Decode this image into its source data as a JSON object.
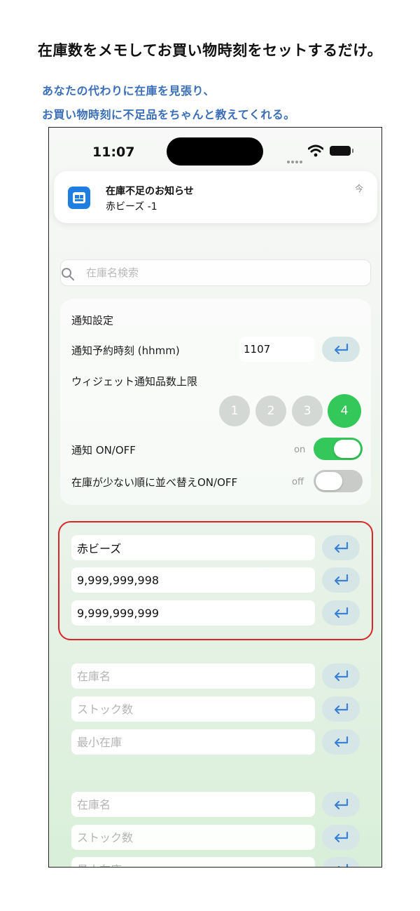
{
  "promo": {
    "headline": "在庫数をメモしてお買い物時刻をセットするだけ。",
    "subline1": "あなたの代わりに在庫を見張り、",
    "subline2": "お買い物時刻に不足品をちゃんと教えてくれる。"
  },
  "status_bar": {
    "time": "11:07"
  },
  "notification": {
    "title": "在庫不足のお知らせ",
    "body": "赤ビーズ  -1",
    "time": "今",
    "app_icon": "app-icon"
  },
  "search": {
    "placeholder": "在庫名検索",
    "icon": "search-icon"
  },
  "settings": {
    "section_title": "通知設定",
    "time_label": "通知予約時刻 (hhmm)",
    "time_value": "1107",
    "widget_limit_label": "ウィジェット通知品数上限",
    "widget_limit_options": [
      "1",
      "2",
      "3",
      "4"
    ],
    "widget_limit_selected": "4",
    "notify_label": "通知 ON/OFF",
    "notify_state": "on",
    "sort_label": "在庫が少ない順に並べ替えON/OFF",
    "sort_state": "off"
  },
  "items": [
    {
      "name": "赤ビーズ",
      "stock": "9,999,999,998",
      "min_stock": "9,999,999,999"
    },
    {
      "name": "",
      "stock": "",
      "min_stock": ""
    },
    {
      "name": "",
      "stock": "",
      "min_stock": ""
    },
    {
      "name": "",
      "stock": "",
      "min_stock": ""
    }
  ],
  "placeholders": {
    "name": "在庫名",
    "stock": "ストック数",
    "min_stock": "最小在庫"
  },
  "colors": {
    "accent_green": "#34c759",
    "promo_blue": "#3a6fb8",
    "highlight_red": "#d9252a",
    "app_blue": "#1f7fe0"
  }
}
